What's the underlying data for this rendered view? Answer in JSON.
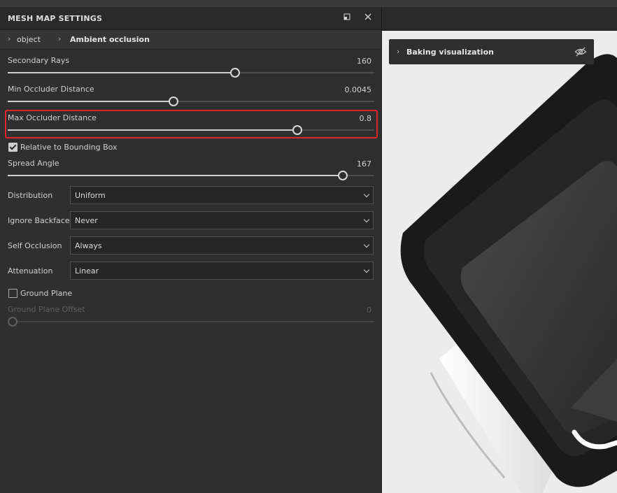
{
  "panel": {
    "title": "MESH MAP SETTINGS",
    "breadcrumb": {
      "item1": "object",
      "item2": "Ambient occlusion"
    }
  },
  "sliders": {
    "secondary_rays": {
      "label": "Secondary Rays",
      "value": "160",
      "position": 0.62
    },
    "min_occluder": {
      "label": "Min Occluder Distance",
      "value": "0.0045",
      "position": 0.452
    },
    "max_occluder": {
      "label": "Max Occluder Distance",
      "value": "0.8",
      "position": 0.79
    },
    "spread_angle": {
      "label": "Spread Angle",
      "value": "167",
      "position": 0.915
    },
    "ground_offset": {
      "label": "Ground Plane Offset",
      "value": "0",
      "position": 0.0
    }
  },
  "checks": {
    "relative_bbox": {
      "label": "Relative to Bounding Box",
      "checked": true
    },
    "ground_plane": {
      "label": "Ground Plane",
      "checked": false
    }
  },
  "dropdowns": {
    "distribution": {
      "label": "Distribution",
      "value": "Uniform"
    },
    "ignore_backface": {
      "label": "Ignore Backface",
      "value": "Never"
    },
    "self_occlusion": {
      "label": "Self Occlusion",
      "value": "Always"
    },
    "attenuation": {
      "label": "Attenuation",
      "value": "Linear"
    }
  },
  "viewport": {
    "baking_label": "Baking visualization",
    "eye_icon": "eye-off-icon"
  },
  "colors": {
    "highlight": "#e0222a",
    "panel_bg": "#2f2f2f",
    "viewport_bg": "#ececec"
  }
}
